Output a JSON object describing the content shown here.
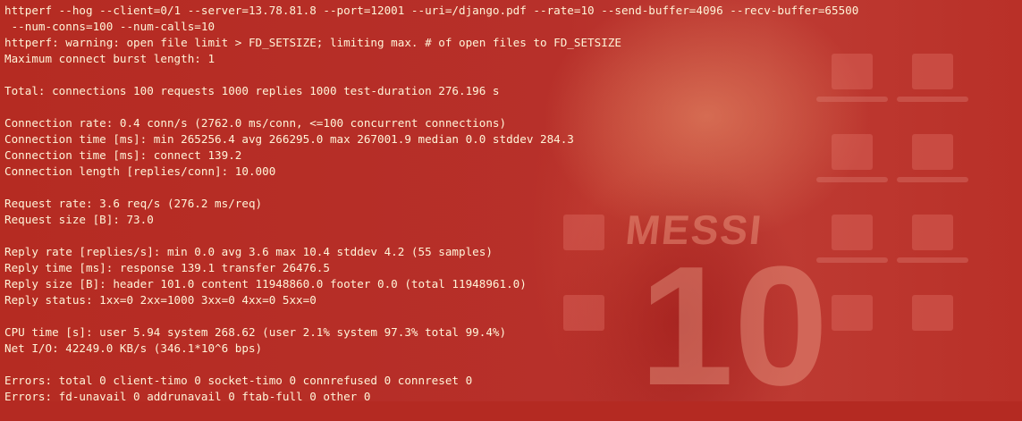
{
  "terminal": {
    "lines": [
      "httperf --hog --client=0/1 --server=13.78.81.8 --port=12001 --uri=/django.pdf --rate=10 --send-buffer=4096 --recv-buffer=65500",
      " --num-conns=100 --num-calls=10",
      "httperf: warning: open file limit > FD_SETSIZE; limiting max. # of open files to FD_SETSIZE",
      "Maximum connect burst length: 1",
      "",
      "Total: connections 100 requests 1000 replies 1000 test-duration 276.196 s",
      "",
      "Connection rate: 0.4 conn/s (2762.0 ms/conn, <=100 concurrent connections)",
      "Connection time [ms]: min 265256.4 avg 266295.0 max 267001.9 median 0.0 stddev 284.3",
      "Connection time [ms]: connect 139.2",
      "Connection length [replies/conn]: 10.000",
      "",
      "Request rate: 3.6 req/s (276.2 ms/req)",
      "Request size [B]: 73.0",
      "",
      "Reply rate [replies/s]: min 0.0 avg 3.6 max 10.4 stddev 4.2 (55 samples)",
      "Reply time [ms]: response 139.1 transfer 26476.5",
      "Reply size [B]: header 101.0 content 11948860.0 footer 0.0 (total 11948961.0)",
      "Reply status: 1xx=0 2xx=1000 3xx=0 4xx=0 5xx=0",
      "",
      "CPU time [s]: user 5.94 system 268.62 (user 2.1% system 97.3% total 99.4%)",
      "Net I/O: 42249.0 KB/s (346.1*10^6 bps)",
      "",
      "Errors: total 0 client-timo 0 socket-timo 0 connrefused 0 connreset 0",
      "Errors: fd-unavail 0 addrunavail 0 ftab-full 0 other 0"
    ]
  },
  "wallpaper": {
    "jersey_name": "MESSI",
    "jersey_number": "10"
  },
  "colors": {
    "terminal_text": "#fff4d8",
    "background": "#b42a22"
  }
}
